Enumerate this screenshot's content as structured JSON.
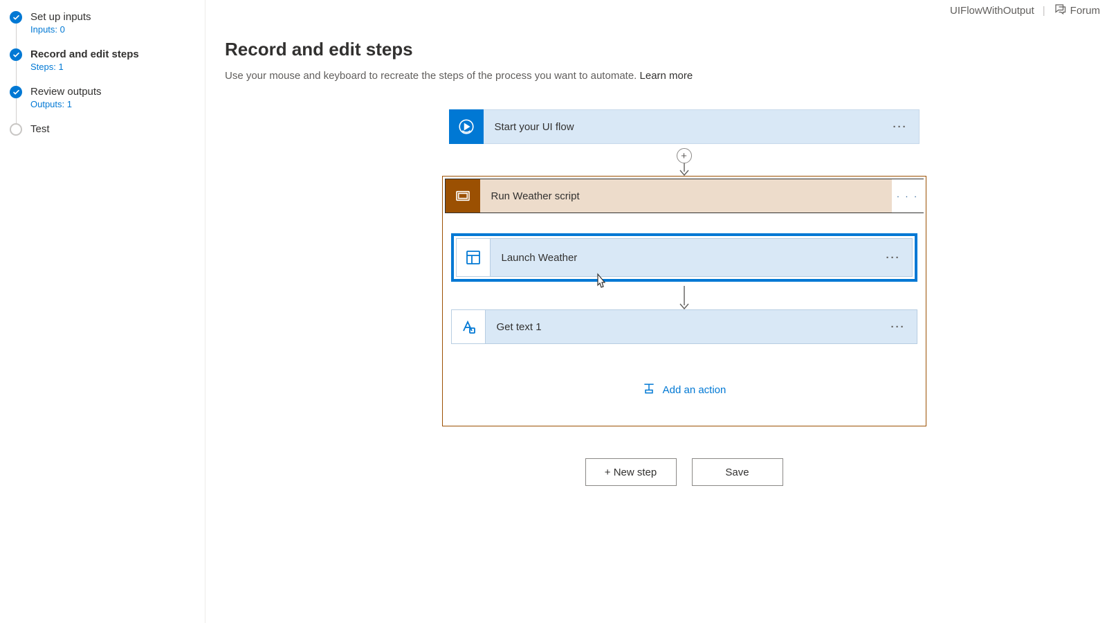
{
  "header": {
    "flow_name": "UIFlowWithOutput",
    "forum_label": "Forum"
  },
  "sidebar": {
    "items": [
      {
        "title": "Set up inputs",
        "sub": "Inputs: 0",
        "state": "done",
        "active": false
      },
      {
        "title": "Record and edit steps",
        "sub": "Steps: 1",
        "state": "done",
        "active": true
      },
      {
        "title": "Review outputs",
        "sub": "Outputs: 1",
        "state": "done",
        "active": false
      },
      {
        "title": "Test",
        "sub": "",
        "state": "empty",
        "active": false
      }
    ]
  },
  "main": {
    "title": "Record and edit steps",
    "subtitle": "Use your mouse and keyboard to recreate the steps of the process you want to automate.  ",
    "learn_more": "Learn more"
  },
  "flow": {
    "start_label": "Start your UI flow",
    "scope": {
      "title": "Run Weather script",
      "actions": [
        {
          "label": "Launch Weather",
          "icon": "window-icon",
          "selected": true
        },
        {
          "label": "Get text 1",
          "icon": "text-icon",
          "selected": false
        }
      ],
      "add_action_label": "Add an action"
    }
  },
  "buttons": {
    "new_step": "+ New step",
    "save": "Save"
  }
}
